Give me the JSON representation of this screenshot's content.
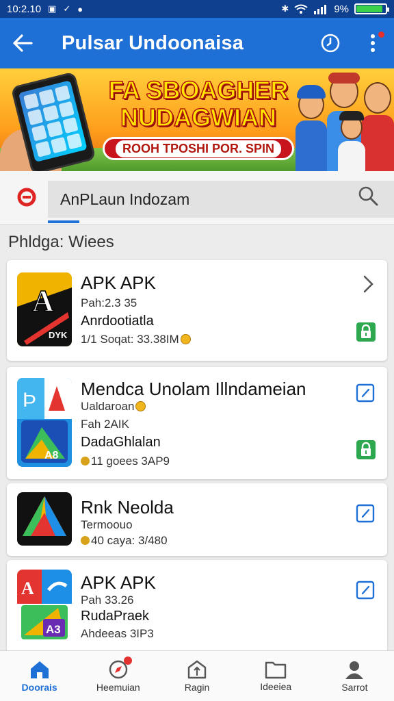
{
  "status_bar": {
    "time": "10:2.10",
    "battery_text": "9%",
    "battery_level": 0.9
  },
  "app_bar": {
    "title": "Pulsar Undoonaisa"
  },
  "banner": {
    "title_line1": "FA SBOAGHER",
    "title_line2": "NUDAGWIAN",
    "pill_text": "ROOH TPOSHI POR. SPIN"
  },
  "search": {
    "value": "AnPLaun Indozam"
  },
  "section_title": "Phldga: Wiees",
  "apps": [
    {
      "title": "APK APK",
      "line1": "Pah:2.3 35",
      "line2": "Anrdootiatla",
      "line3": "1/1 Soqat: 33.38IM",
      "lead_coin": false,
      "trailing_coin": true,
      "top_action": "chevron",
      "locked": true
    },
    {
      "title": "Mendca Unolam Illndameian",
      "line1": "Ualdaroan",
      "line1_coin": true,
      "line2": "Fah 2AIK",
      "line3": "DadaGhlalan",
      "line4": "11 goees 3AP9",
      "top_action": "edit",
      "locked": true
    },
    {
      "title": "Rnk Neolda",
      "line1": "Termoouo",
      "line2": "40 caya: 3/480",
      "top_action": "edit",
      "locked": false
    },
    {
      "title": "APK APK",
      "line1": "Pah 33.26",
      "line2": "RudaPraek",
      "line3": "Ahdeeas 3IP3",
      "top_action": "edit",
      "locked": false
    }
  ],
  "bottom_nav": [
    {
      "label": "Doorais",
      "icon": "home-icon",
      "active": true
    },
    {
      "label": "Heemuian",
      "icon": "compass-icon",
      "badge": true
    },
    {
      "label": "Ragin",
      "icon": "upload-icon"
    },
    {
      "label": "Ideeiea",
      "icon": "folder-icon"
    },
    {
      "label": "Sarrot",
      "icon": "profile-icon"
    }
  ],
  "colors": {
    "primary": "#1e6fd6",
    "status_bar": "#0f3f8f",
    "lock_green": "#2ea84f",
    "badge_red": "#e53030"
  }
}
